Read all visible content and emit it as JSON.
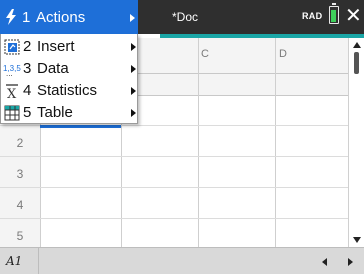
{
  "titlebar": {
    "doc_name": "*Doc",
    "angle_mode": "RAD",
    "close_glyph": "✕",
    "battery_color": "#3fd05b",
    "accent_color": "#1aa6a6"
  },
  "menu": {
    "items": [
      {
        "num": "1",
        "label": "Actions",
        "icon": "lightning-icon",
        "selected": true
      },
      {
        "num": "2",
        "label": "Insert",
        "icon": "insert-cell-icon",
        "selected": false
      },
      {
        "num": "3",
        "label": "Data",
        "icon": "data-sequence-icon",
        "selected": false
      },
      {
        "num": "4",
        "label": "Statistics",
        "icon": "mean-icon",
        "selected": false
      },
      {
        "num": "5",
        "label": "Table",
        "icon": "table-icon",
        "selected": false
      }
    ],
    "highlight_color": "#1e6fd8"
  },
  "sheet": {
    "column_headers": [
      "C",
      "D"
    ],
    "row_numbers": [
      "2",
      "3",
      "4",
      "5"
    ],
    "selection_color": "#1e6fd8"
  },
  "bottombar": {
    "cell_reference": "A1"
  }
}
